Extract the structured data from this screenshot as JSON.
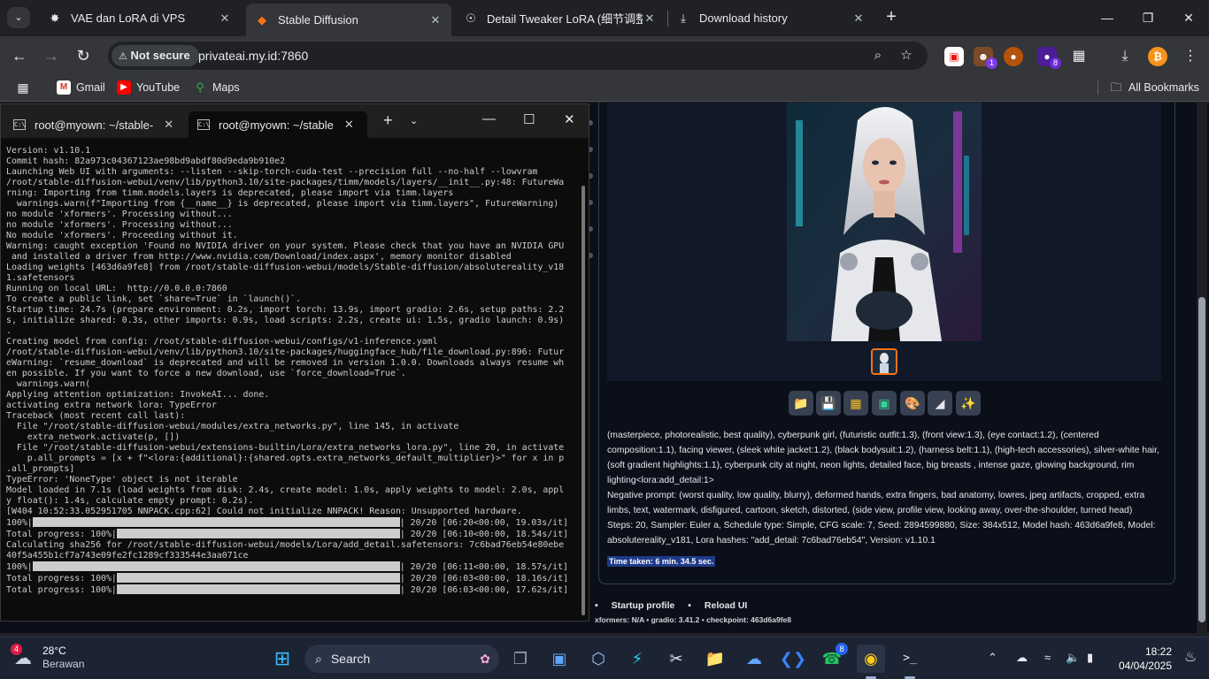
{
  "browser": {
    "tabs": [
      {
        "title": "VAE dan LoRA di VPS",
        "icon": "chatgpt-icon",
        "active": false
      },
      {
        "title": "Stable Diffusion",
        "icon": "gradio-icon",
        "active": true
      },
      {
        "title": "Detail Tweaker LoRA (细节调整",
        "icon": "globe-icon",
        "active": false
      },
      {
        "title": "Download history",
        "icon": "download-icon",
        "active": false
      }
    ],
    "security_label": "Not secure",
    "url": "privateai.my.id:7860",
    "bookmarks": [
      "Gmail",
      "YouTube",
      "Maps"
    ],
    "all_bookmarks": "All Bookmarks",
    "extension_badges": {
      "ext2": "1",
      "ext4": "8"
    },
    "accent": "#35363a"
  },
  "terminal": {
    "tabs": [
      "root@myown: ~/stable-",
      "root@myown: ~/stable"
    ],
    "lines": [
      "Version: v1.10.1",
      "Commit hash: 82a973c04367123ae98bd9abdf80d9eda9b910e2",
      "Launching Web UI with arguments: --listen --skip-torch-cuda-test --precision full --no-half --lowvram",
      "/root/stable-diffusion-webui/venv/lib/python3.10/site-packages/timm/models/layers/__init__.py:48: FutureWa",
      "rning: Importing from timm.models.layers is deprecated, please import via timm.layers",
      "  warnings.warn(f\"Importing from {__name__} is deprecated, please import via timm.layers\", FutureWarning)",
      "no module 'xformers'. Processing without...",
      "no module 'xformers'. Processing without...",
      "No module 'xformers'. Proceeding without it.",
      "Warning: caught exception 'Found no NVIDIA driver on your system. Please check that you have an NVIDIA GPU",
      " and installed a driver from http://www.nvidia.com/Download/index.aspx', memory monitor disabled",
      "Loading weights [463d6a9fe8] from /root/stable-diffusion-webui/models/Stable-diffusion/absolutereality_v18",
      "1.safetensors",
      "Running on local URL:  http://0.0.0.0:7860",
      "",
      "To create a public link, set `share=True` in `launch()`.",
      "Startup time: 24.7s (prepare environment: 0.2s, import torch: 13.9s, import gradio: 2.6s, setup paths: 2.2",
      "s, initialize shared: 0.3s, other imports: 0.9s, load scripts: 2.2s, create ui: 1.5s, gradio launch: 0.9s)",
      ".",
      "Creating model from config: /root/stable-diffusion-webui/configs/v1-inference.yaml",
      "/root/stable-diffusion-webui/venv/lib/python3.10/site-packages/huggingface_hub/file_download.py:896: Futur",
      "eWarning: `resume_download` is deprecated and will be removed in version 1.0.0. Downloads always resume wh",
      "en possible. If you want to force a new download, use `force_download=True`.",
      "  warnings.warn(",
      "Applying attention optimization: InvokeAI... done.",
      "activating extra network lora: TypeError",
      "Traceback (most recent call last):",
      "  File \"/root/stable-diffusion-webui/modules/extra_networks.py\", line 145, in activate",
      "    extra_network.activate(p, [])",
      "  File \"/root/stable-diffusion-webui/extensions-builtin/Lora/extra_networks_lora.py\", line 20, in activate",
      "    p.all_prompts = [x + f\"<lora:{additional}:{shared.opts.extra_networks_default_multiplier}>\" for x in p",
      ".all_prompts]",
      "TypeError: 'NoneType' object is not iterable",
      "",
      "Model loaded in 7.1s (load weights from disk: 2.4s, create model: 1.0s, apply weights to model: 2.0s, appl",
      "y float(): 1.4s, calculate empty prompt: 0.2s).",
      "[W404 10:52:33.052951705 NNPACK.cpp:62] Could not initialize NNPACK! Reason: Unsupported hardware."
    ],
    "progress_lines": [
      {
        "prefix": "100%|",
        "bar": 415,
        "suffix": "| 20/20 [06:20<00:00, 19.03s/it]"
      },
      {
        "prefix": "Total progress: 100%|",
        "bar": 320,
        "suffix": "| 20/20 [06:10<00:00, 18.54s/it]"
      }
    ],
    "sha_lines": [
      "Calculating sha256 for /root/stable-diffusion-webui/models/Lora/add_detail.safetensors: 7c6bad76eb54e80ebe",
      "40f5a455b1cf7a743e09fe2fc1289cf333544e3aa071ce"
    ],
    "progress_lines2": [
      {
        "prefix": "100%|",
        "bar": 415,
        "suffix": "| 20/20 [06:11<00:00, 18.57s/it]"
      },
      {
        "prefix": "Total progress: 100%|",
        "bar": 320,
        "suffix": "| 20/20 [06:03<00:00, 18.16s/it]"
      },
      {
        "prefix": "Total progress: 100%|",
        "bar": 320,
        "suffix": "| 20/20 [06:03<00:00, 17.62s/it]"
      }
    ]
  },
  "webui": {
    "action_buttons": [
      "folder-icon",
      "save-icon",
      "zip-icon",
      "image-icon",
      "palette-icon",
      "ruler-icon",
      "sparkle-icon"
    ],
    "prompt": "(masterpiece, photorealistic, best quality), cyberpunk girl, (futuristic outfit:1.3), (front view:1.3), (eye contact:1.2), (centered composition:1.1), facing viewer, (sleek white jacket:1.2), (black bodysuit:1.2), (harness belt:1.1), (high-tech accessories), silver-white hair, (soft gradient highlights:1.1), cyberpunk city at night, neon lights, detailed face, big breasts , intense gaze, glowing background, rim lighting<lora:add_detail:1>",
    "negative_prompt": "Negative prompt: (worst quality, low quality, blurry), deformed hands, extra fingers, bad anatomy, lowres, jpeg artifacts, cropped, extra limbs, text, watermark, disfigured, cartoon, sketch, distorted, (side view, profile view, looking away, over-the-shoulder, turned head)",
    "params": "Steps: 20, Sampler: Euler a, Schedule type: Simple, CFG scale: 7, Seed: 2894599880, Size: 384x512, Model hash: 463d6a9fe8, Model: absolutereality_v181, Lora hashes: \"add_detail: 7c6bad76eb54\", Version: v1.10.1",
    "time_taken": "Time taken: 6 min. 34.5 sec.",
    "footer_links": [
      "Startup profile",
      "Reload UI"
    ],
    "footer_versions": "xformers: N/A  •  gradio: 3.41.2  •  checkpoint: 463d6a9fe8"
  },
  "taskbar": {
    "weather_temp": "28°C",
    "weather_desc": "Berawan",
    "weather_badge": "4",
    "search_label": "Search",
    "whatsapp_badge": "8",
    "time": "18:22",
    "date": "04/04/2025"
  }
}
